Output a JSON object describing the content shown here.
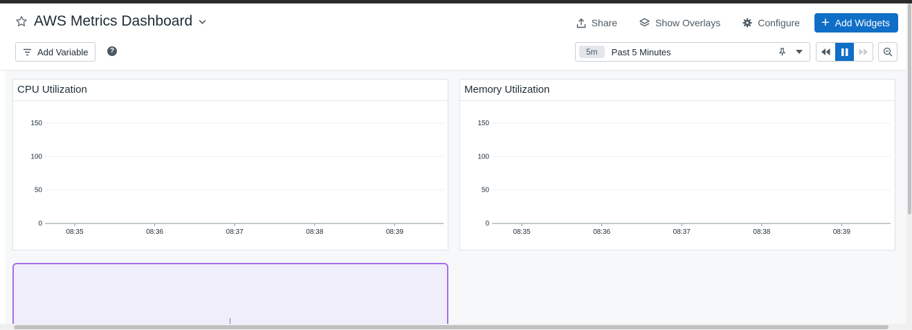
{
  "dashboard": {
    "title": "AWS Metrics Dashboard",
    "star_icon": "star-icon",
    "dropdown_icon": "chevron-down-icon"
  },
  "toolbar": {
    "share_label": "Share",
    "overlays_label": "Show Overlays",
    "configure_label": "Configure",
    "add_widgets_label": "Add Widgets",
    "add_variable_label": "Add Variable",
    "help_label": "?"
  },
  "timepicker": {
    "badge": "5m",
    "range": "Past 5 Minutes"
  },
  "colors": {
    "accent": "#0f6ec6",
    "widget_highlight": "#a46ce8"
  },
  "widgets": [
    {
      "title": "CPU Utilization"
    },
    {
      "title": "Memory Utilization"
    }
  ],
  "chart_data": [
    {
      "type": "line",
      "title": "CPU Utilization",
      "x": [
        "08:35",
        "08:36",
        "08:37",
        "08:38",
        "08:39"
      ],
      "yticks": [
        "0",
        "50",
        "100",
        "150"
      ],
      "ylim": [
        0,
        150
      ],
      "series": [],
      "grid": true
    },
    {
      "type": "line",
      "title": "Memory Utilization",
      "x": [
        "08:35",
        "08:36",
        "08:37",
        "08:38",
        "08:39"
      ],
      "yticks": [
        "0",
        "50",
        "100",
        "150"
      ],
      "ylim": [
        0,
        150
      ],
      "series": [],
      "grid": true
    }
  ]
}
